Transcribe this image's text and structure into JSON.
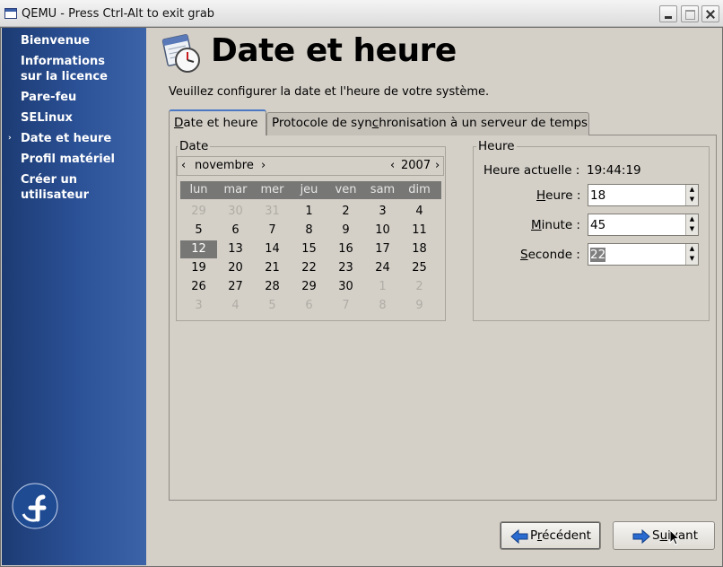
{
  "window": {
    "title": "QEMU - Press Ctrl-Alt to exit grab"
  },
  "sidebar": {
    "items": [
      {
        "label": "Bienvenue",
        "current": false
      },
      {
        "label": "Informations sur la licence",
        "line1": "Informations",
        "line2": "sur la licence",
        "current": false
      },
      {
        "label": "Pare-feu",
        "current": false
      },
      {
        "label": "SELinux",
        "current": false
      },
      {
        "label": "Date et heure",
        "current": true
      },
      {
        "label": "Profil matériel",
        "current": false
      },
      {
        "label": "Créer un utilisateur",
        "line1": "Créer un",
        "line2": "utilisateur",
        "current": false
      }
    ],
    "current_marker": "›"
  },
  "page": {
    "title": "Date et heure",
    "subtitle": "Veuillez configurer la date et l'heure de votre système."
  },
  "tabs": [
    {
      "label": "Date et heure",
      "active": true
    },
    {
      "label": "Protocole de synchronisation à un serveur de temps",
      "active": false
    }
  ],
  "date_panel": {
    "label": "Date",
    "month": "novembre",
    "year": "2007",
    "prev": "‹",
    "next": "›",
    "weekdays": [
      "lun",
      "mar",
      "mer",
      "jeu",
      "ven",
      "sam",
      "dim"
    ],
    "weeks": [
      [
        "29",
        "30",
        "31",
        "1",
        "2",
        "3",
        "4"
      ],
      [
        "5",
        "6",
        "7",
        "8",
        "9",
        "10",
        "11"
      ],
      [
        "12",
        "13",
        "14",
        "15",
        "16",
        "17",
        "18"
      ],
      [
        "19",
        "20",
        "21",
        "22",
        "23",
        "24",
        "25"
      ],
      [
        "26",
        "27",
        "28",
        "29",
        "30",
        "1",
        "2"
      ],
      [
        "3",
        "4",
        "5",
        "6",
        "7",
        "8",
        "9"
      ]
    ],
    "selected_day": "12"
  },
  "time_panel": {
    "label": "Heure",
    "current_label": "Heure actuelle :",
    "current_value": "19:44:19",
    "hour_label": "Heure :",
    "hour_value": "18",
    "minute_label": "Minute :",
    "minute_value": "45",
    "second_label": "Seconde :",
    "second_value": "22"
  },
  "buttons": {
    "back": "Précédent",
    "next": "Suivant"
  },
  "colors": {
    "sidebar_top": "#1c3b73",
    "sidebar_bottom": "#3c63a8",
    "selection": "#777775",
    "arrow": "#2a6bd1"
  }
}
